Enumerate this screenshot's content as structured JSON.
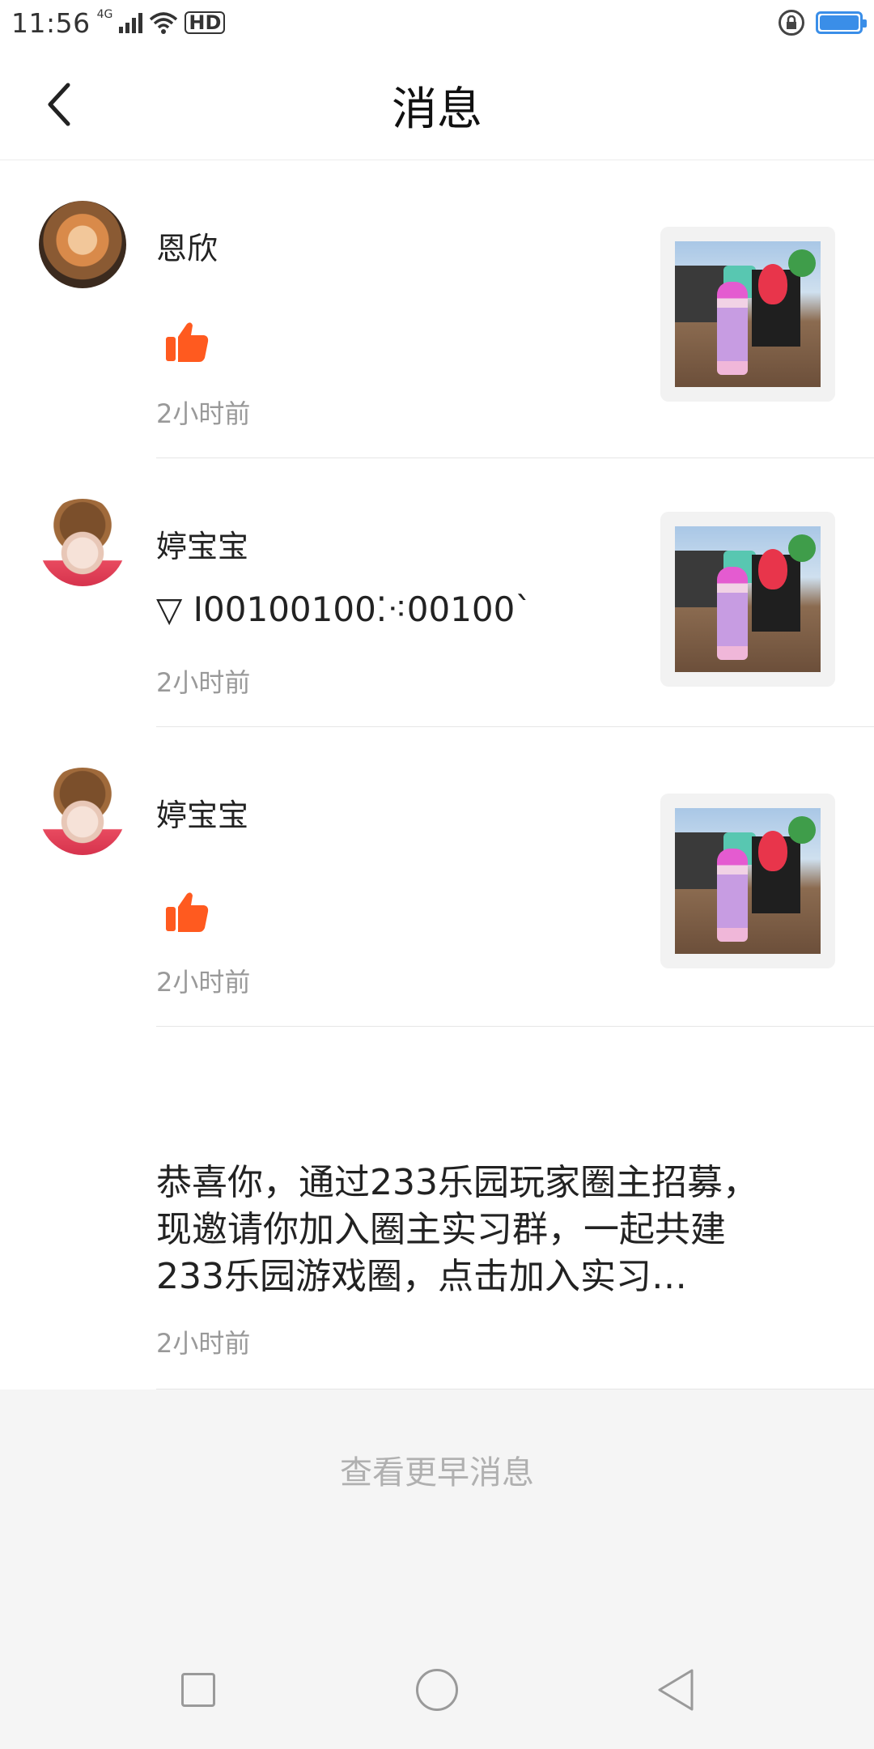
{
  "status": {
    "time": "11:56",
    "network": "4G",
    "hd": "HD"
  },
  "header": {
    "title": "消息"
  },
  "messages": [
    {
      "nickname": "恩欣",
      "type": "like",
      "content": "",
      "time": "2小时前"
    },
    {
      "nickname": "婷宝宝",
      "type": "comment",
      "content": "▽ I00100100⁚⁖00100`",
      "time": "2小时前"
    },
    {
      "nickname": "婷宝宝",
      "type": "like",
      "content": "",
      "time": "2小时前"
    }
  ],
  "system_message": {
    "text": "恭喜你，通过233乐园玩家圈主招募，现邀请你加入圈主实习群，一起共建233乐园游戏圈，点击加入实习…",
    "time": "2小时前"
  },
  "more_label": "查看更早消息",
  "colors": {
    "like": "#ff5a1f",
    "accent_battery": "#3a8ee8",
    "muted": "#999999"
  },
  "icons": [
    "back-arrow-icon",
    "thumbs-up-icon",
    "lock-icon",
    "wifi-icon",
    "signal-icon",
    "battery-icon",
    "nav-recent-icon",
    "nav-home-icon",
    "nav-back-icon"
  ]
}
